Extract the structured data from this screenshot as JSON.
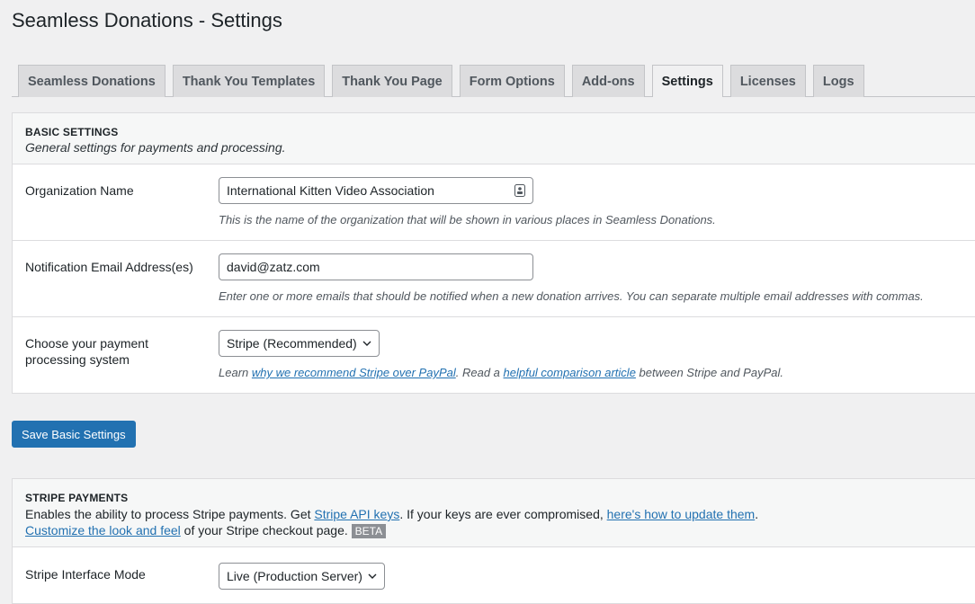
{
  "page": {
    "title": "Seamless Donations - Settings"
  },
  "tabs": [
    {
      "label": "Seamless Donations"
    },
    {
      "label": "Thank You Templates"
    },
    {
      "label": "Thank You Page"
    },
    {
      "label": "Form Options"
    },
    {
      "label": "Add-ons"
    },
    {
      "label": "Settings"
    },
    {
      "label": "Licenses"
    },
    {
      "label": "Logs"
    }
  ],
  "basic": {
    "heading": "BASIC SETTINGS",
    "description": "General settings for payments and processing.",
    "org": {
      "label": "Organization Name",
      "value": "International Kitten Video Association",
      "hint": "This is the name of the organization that will be shown in various places in Seamless Donations."
    },
    "email": {
      "label": "Notification Email Address(es)",
      "value": "david@zatz.com",
      "hint": "Enter one or more emails that should be notified when a new donation arrives. You can separate multiple email addresses with commas."
    },
    "payment": {
      "label": "Choose your payment processing system",
      "selected": "Stripe (Recommended)",
      "hint_prefix": "Learn ",
      "hint_link1": "why we recommend Stripe over PayPal",
      "hint_mid": ". Read a ",
      "hint_link2": "helpful comparison article",
      "hint_suffix": " between Stripe and PayPal."
    },
    "save_label": "Save Basic Settings"
  },
  "stripe": {
    "heading": "STRIPE PAYMENTS",
    "desc_prefix": "Enables the ability to process Stripe payments. Get ",
    "link_keys": "Stripe API keys",
    "desc_mid": ". If your keys are ever compromised, ",
    "link_update": "here's how to update them",
    "desc_end": ".",
    "link_customize": "Customize the look and feel",
    "desc_tail": " of your Stripe checkout page. ",
    "beta": "BETA",
    "mode": {
      "label": "Stripe Interface Mode",
      "selected": "Live (Production Server)"
    }
  }
}
